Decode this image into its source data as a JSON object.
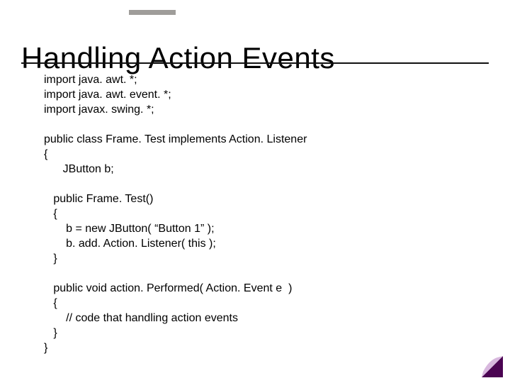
{
  "title": "Handling Action Events",
  "code": "import java. awt. *;\nimport java. awt. event. *;\nimport javax. swing. *;\n\npublic class Frame. Test implements Action. Listener\n{\n      JButton b;\n\n   public Frame. Test()\n   {\n       b = new JButton( “Button 1” );\n       b. add. Action. Listener( this );\n   }\n\n   public void action. Performed( Action. Event e  )\n   {\n       // code that handling action events\n   }\n}"
}
